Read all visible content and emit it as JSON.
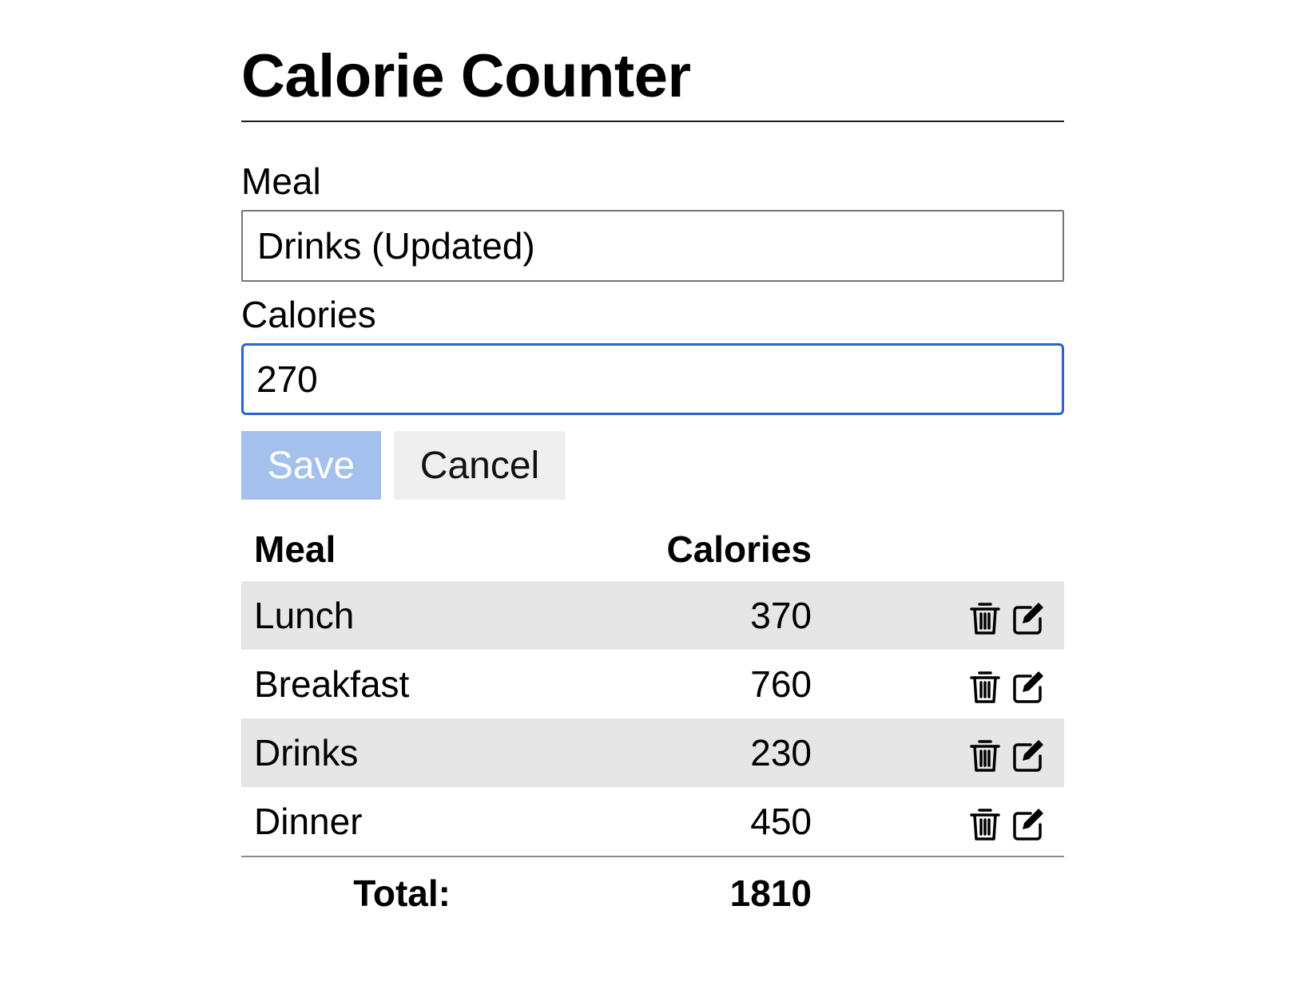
{
  "header": {
    "title": "Calorie Counter"
  },
  "form": {
    "meal_label": "Meal",
    "meal_value": "Drinks (Updated)",
    "calories_label": "Calories",
    "calories_value": "270",
    "save_label": "Save",
    "cancel_label": "Cancel"
  },
  "table": {
    "headers": {
      "meal": "Meal",
      "calories": "Calories"
    },
    "rows": [
      {
        "meal": "Lunch",
        "calories": "370"
      },
      {
        "meal": "Breakfast",
        "calories": "760"
      },
      {
        "meal": "Drinks",
        "calories": "230"
      },
      {
        "meal": "Dinner",
        "calories": "450"
      }
    ],
    "total_label": "Total:",
    "total_value": "1810"
  },
  "icons": {
    "delete": "trash-icon",
    "edit": "edit-icon"
  },
  "colors": {
    "focus_border": "#2764d1",
    "save_button_bg": "#a3c1ec",
    "cancel_button_bg": "#efefef",
    "shaded_row_bg": "#e6e6e6"
  }
}
